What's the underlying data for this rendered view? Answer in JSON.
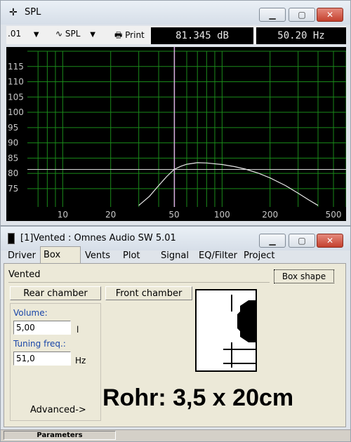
{
  "spl_window": {
    "title": "SPL",
    "toolbar": {
      "step_value": ".01",
      "mode_label": "SPL",
      "print_label": "Print"
    },
    "readouts": {
      "level": "81.345 dB",
      "frequency": "50.20 Hz"
    }
  },
  "chart_data": {
    "type": "line",
    "xscale": "log",
    "xlim": [
      6,
      600
    ],
    "ylim": [
      69,
      120
    ],
    "x_ticks": [
      10,
      20,
      50,
      100,
      200,
      500
    ],
    "y_ticks": [
      75,
      80,
      85,
      90,
      95,
      100,
      105,
      110,
      115
    ],
    "cursor_x": 50.2,
    "reference_y": 81.3,
    "grid": true,
    "colors": {
      "background": "#000000",
      "grid": "#1a8a1a",
      "curve": "#e8e8e8",
      "cursor": "#d8a8e0",
      "tick_labels": "#c8c8c8"
    },
    "series": [
      {
        "x": [
          30,
          35,
          40,
          45,
          50,
          55,
          60,
          70,
          80,
          100,
          120,
          140,
          170,
          200,
          250,
          300,
          350,
          400
        ],
        "values": [
          69.5,
          72.5,
          76,
          79,
          81.3,
          82.3,
          83,
          83.5,
          83.4,
          82.9,
          82.2,
          81.4,
          80,
          78.5,
          76,
          73.5,
          71.3,
          69.5
        ]
      }
    ]
  },
  "vented_window": {
    "title": "[1]Vented : Omnes Audio SW 5.01",
    "tabs": [
      "Driver",
      "Box",
      "Vents",
      "Plot",
      "Signal",
      "EQ/Filter",
      "Project"
    ],
    "box_type": "Vented",
    "box_shape_label": "Box shape",
    "rear_chamber_label": "Rear chamber",
    "front_chamber_label": "Front chamber",
    "volume": {
      "label": "Volume:",
      "value": "5,00",
      "unit": "l"
    },
    "tuning": {
      "label": "Tuning freq.:",
      "value": "51,0",
      "unit": "Hz"
    },
    "advanced_label": "Advanced->",
    "annotation": "Rohr: 3,5 x 20cm",
    "status_label": "Parameters"
  }
}
